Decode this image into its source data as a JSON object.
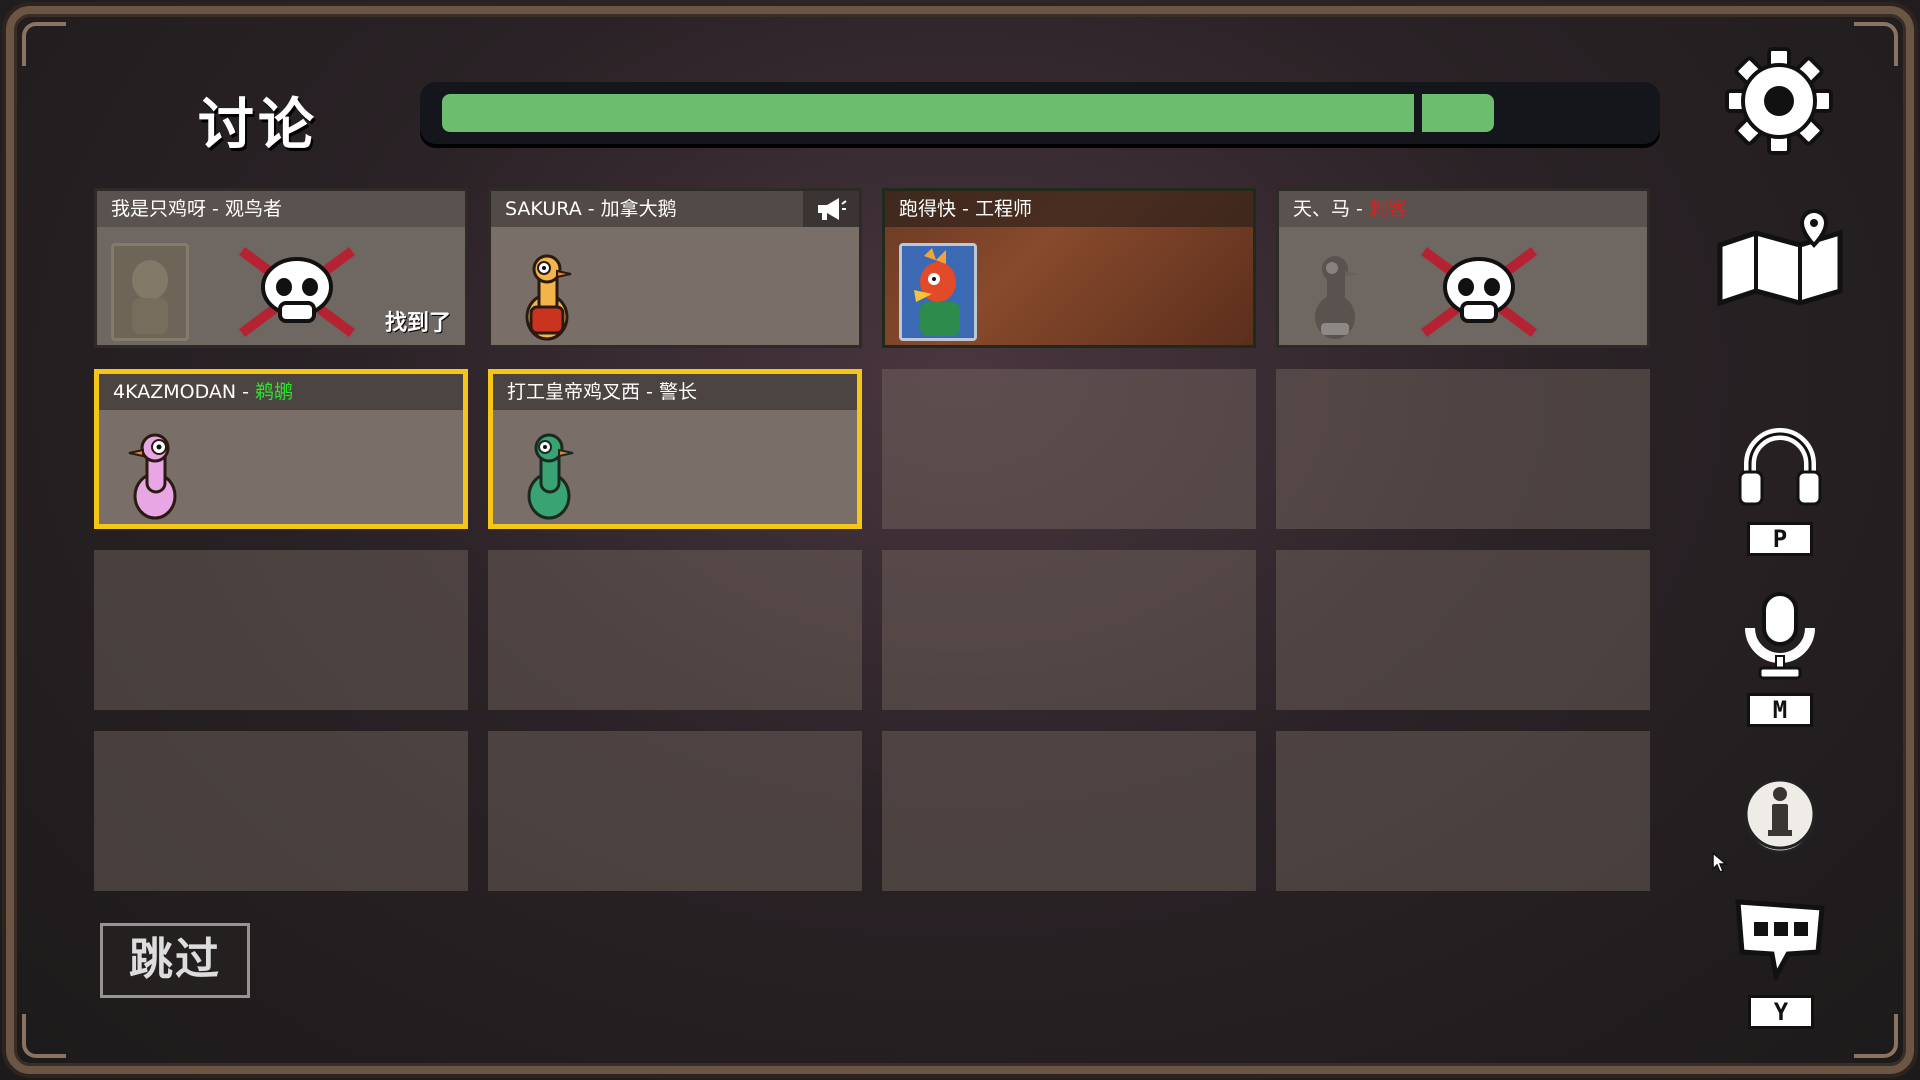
{
  "header": {
    "title": "讨论",
    "timer_progress": 0.88
  },
  "players": [
    {
      "name": "我是只鸡呀",
      "sep": " - ",
      "role": "观鸟者",
      "role_color": "#ffffff",
      "status": "dead",
      "found_label": "找到了"
    },
    {
      "name": "SAKURA",
      "sep": " - ",
      "role": "加拿大鹅",
      "role_color": "#ffffff",
      "status": "alive",
      "speaking": true
    },
    {
      "name": "跑得快",
      "sep": " - ",
      "role": "工程师",
      "role_color": "#ffffff",
      "status": "alive"
    },
    {
      "name": "天、马",
      "sep": " - ",
      "role": "刺客",
      "role_color": "#e21d1d",
      "status": "dead"
    },
    {
      "name": "4KAZMODAN",
      "sep": " - ",
      "role": "鹈鹕",
      "role_color": "#2fe32f",
      "status": "alive",
      "highlighted": true
    },
    {
      "name": "打工皇帝鸡叉西",
      "sep": " - ",
      "role": "警长",
      "role_color": "#ffffff",
      "status": "alive",
      "highlighted": true
    }
  ],
  "actions": {
    "skip_label": "跳过"
  },
  "sidebar": {
    "settings_icon": "gear-icon",
    "map_icon": "map-icon",
    "headphones_key": "P",
    "mic_key": "M",
    "info_icon": "info-icon",
    "chat_key": "Y"
  },
  "colors": {
    "highlight": "#f5c518",
    "timer_fill": "#6cbd6e",
    "pink_duck": "#e9a6e4",
    "green_duck": "#3aa373",
    "orange_duck": "#f3b54a"
  }
}
